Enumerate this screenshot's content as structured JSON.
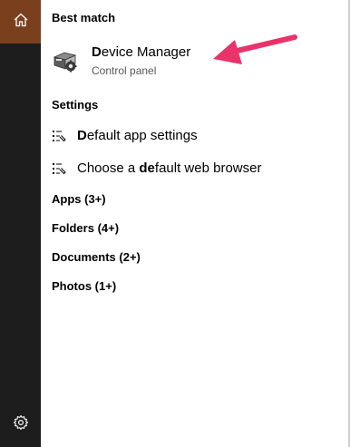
{
  "sections": {
    "best_match": "Best match",
    "settings": "Settings"
  },
  "best_match_item": {
    "title_bold": "D",
    "title_rest": "evice Manager",
    "subtitle": "Control panel",
    "icon": "device-manager-icon"
  },
  "settings_items": [
    {
      "pre": "",
      "bold": "D",
      "post": "efault app settings",
      "icon": "settings-list-icon"
    },
    {
      "pre": "Choose a ",
      "bold": "de",
      "post": "fault web browser",
      "icon": "settings-list-icon"
    }
  ],
  "categories": [
    {
      "label": "Apps (3+)"
    },
    {
      "label": "Folders (4+)"
    },
    {
      "label": "Documents (2+)"
    },
    {
      "label": "Photos (1+)"
    }
  ],
  "rail": {
    "home_icon": "home-icon",
    "settings_icon": "gear-icon"
  },
  "colors": {
    "rail": "#1d1d1d",
    "home_highlight": "#7a3f1d",
    "arrow": "#e8336b"
  }
}
